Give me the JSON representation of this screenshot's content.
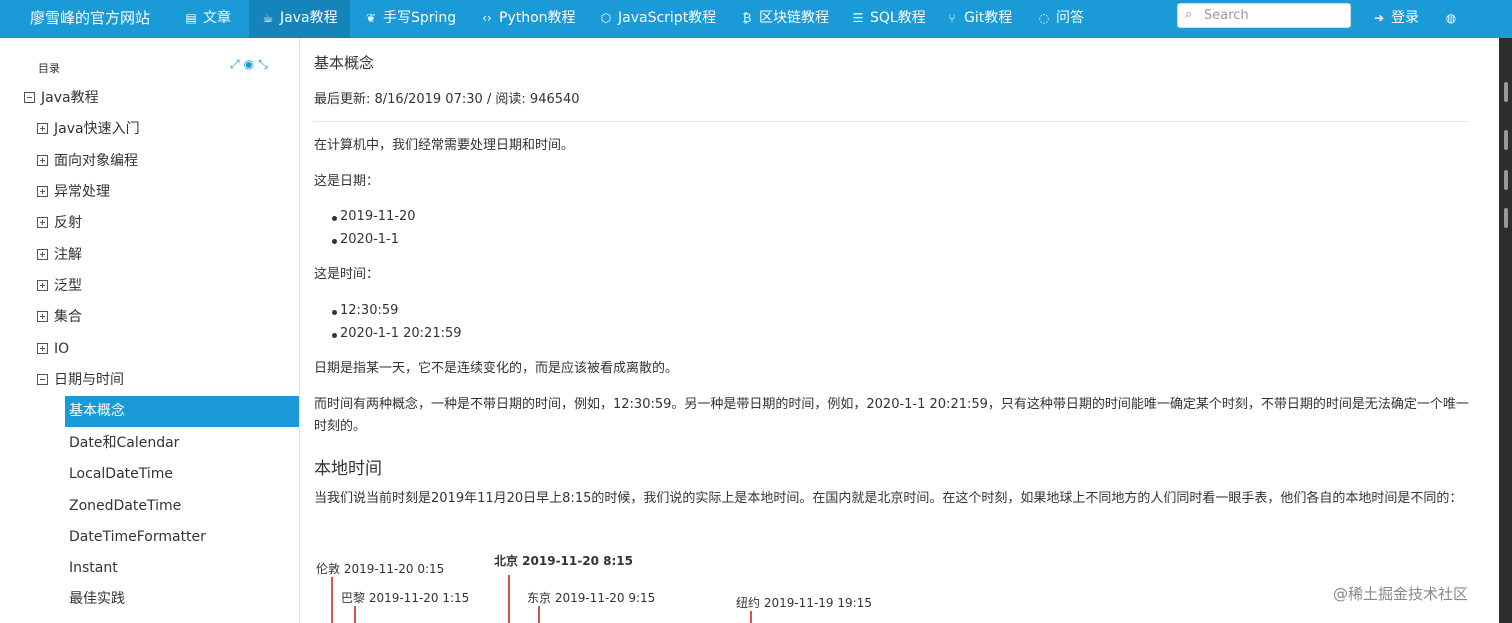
{
  "nav": {
    "brand": "廖雪峰的官方网站",
    "items": [
      {
        "label": "文章",
        "icon": "book-icon"
      },
      {
        "label": "Java教程",
        "icon": "coffee-icon"
      },
      {
        "label": "手写Spring",
        "icon": "leaf-icon"
      },
      {
        "label": "Python教程",
        "icon": "code-icon"
      },
      {
        "label": "JavaScript教程",
        "icon": "html5-icon"
      },
      {
        "label": "区块链教程",
        "icon": "bitcoin-icon"
      },
      {
        "label": "SQL教程",
        "icon": "database-icon"
      },
      {
        "label": "Git教程",
        "icon": "git-icon"
      },
      {
        "label": "问答",
        "icon": "comment-icon"
      }
    ],
    "search_placeholder": "Search",
    "login_label": "登录"
  },
  "sidebar": {
    "title": "目录",
    "root": "Java教程",
    "items": [
      {
        "label": "Java快速入门",
        "expanded": false
      },
      {
        "label": "面向对象编程",
        "expanded": false
      },
      {
        "label": "异常处理",
        "expanded": false
      },
      {
        "label": "反射",
        "expanded": false
      },
      {
        "label": "注解",
        "expanded": false
      },
      {
        "label": "泛型",
        "expanded": false
      },
      {
        "label": "集合",
        "expanded": false
      },
      {
        "label": "IO",
        "expanded": false
      },
      {
        "label": "日期与时间",
        "expanded": true
      }
    ],
    "children": [
      "基本概念",
      "Date和Calendar",
      "LocalDateTime",
      "ZonedDateTime",
      "DateTimeFormatter",
      "Instant",
      "最佳实践"
    ],
    "active_child": "基本概念"
  },
  "article": {
    "title": "基本概念",
    "meta": "最后更新: 8/16/2019 07:30 / 阅读: 946540",
    "p1": "在计算机中，我们经常需要处理日期和时间。",
    "p2": "这是日期：",
    "dates": [
      "2019-11-20",
      "2020-1-1"
    ],
    "p3": "这是时间：",
    "times": [
      "12:30:59",
      "2020-1-1 20:21:59"
    ],
    "p4": "日期是指某一天，它不是连续变化的，而是应该被看成离散的。",
    "p5": "而时间有两种概念，一种是不带日期的时间，例如，12:30:59。另一种是带日期的时间，例如，2020-1-1 20:21:59，只有这种带日期的时间能唯一确定某个时刻，不带日期的时间是无法确定一个唯一时刻的。",
    "h2": "本地时间",
    "p6": "当我们说当前时刻是2019年11月20日早上8:15的时候，我们说的实际上是本地时间。在国内就是北京时间。在这个时刻，如果地球上不同地方的人们同时看一眼手表，他们各自的本地时间是不同的："
  },
  "diagram": {
    "london": "伦敦 2019-11-20 0:15",
    "paris": "巴黎 2019-11-20 1:15",
    "beijing": "北京 2019-11-20 8:15",
    "tokyo": "东京 2019-11-20 9:15",
    "newyork": "纽约 2019-11-19 19:15",
    "accent": "#d9534f"
  },
  "watermark": "@稀土掘金技术社区",
  "colors": {
    "nav_bg": "#1a9ad7",
    "active_bg": "#1a9ad7"
  }
}
